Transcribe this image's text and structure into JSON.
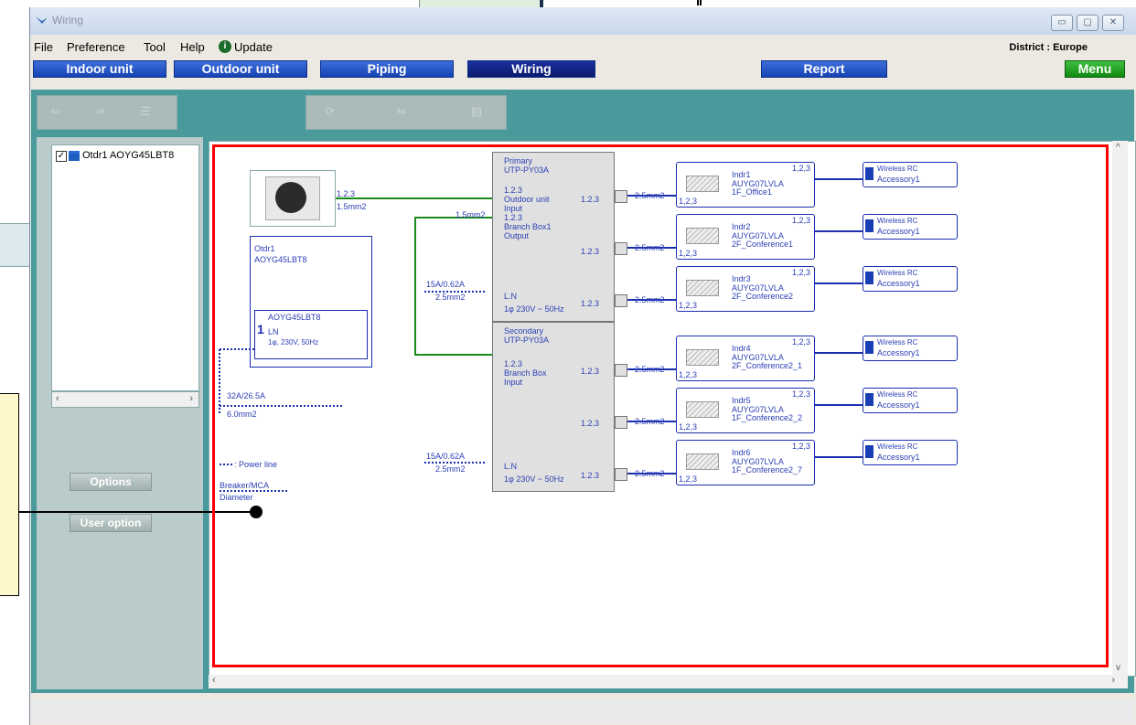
{
  "window": {
    "title": "Wiring",
    "controls": {
      "minimize": "▭",
      "maximize": "▢",
      "close": "✕"
    }
  },
  "menu": {
    "items": [
      "File",
      "Preference",
      "Tool",
      "Help",
      "Update"
    ],
    "district": "District : Europe"
  },
  "tabs": {
    "indoor": "Indoor unit",
    "outdoor": "Outdoor unit",
    "piping": "Piping",
    "wiring": "Wiring",
    "report": "Report",
    "menu": "Menu"
  },
  "tree": {
    "item": "Otdr1 AOYG45LBT8"
  },
  "side": {
    "options": "Options",
    "user_option": "User option"
  },
  "outdoor": {
    "name": "Otdr1",
    "model": "AOYG45LBT8",
    "inner_model": "AOYG45LBT8",
    "number": "1",
    "ln": "LN",
    "power": "1φ, 230V, 50Hz",
    "conn": "1.2.3",
    "wire": "1.5mm2",
    "breaker": "32A/26.5A",
    "diameter": "6.0mm2"
  },
  "legend": {
    "power_line": ": Power line",
    "breaker_mca": "Breaker/MCA",
    "diameter": "Diameter"
  },
  "primary": {
    "title": "Primary",
    "model": "UTP-PY03A",
    "conn1": "1.2.3",
    "l1": "Outdoor unit",
    "l2": "Input",
    "conn2": "1.2.3",
    "l3": "Branch Box1",
    "l4": "Output",
    "ln": "L.N",
    "power": "1φ 230V ~ 50Hz",
    "port": "1.2.3",
    "wire_in": "1.5mm2",
    "breaker": "15A/0.62A",
    "diameter": "2.5mm2"
  },
  "secondary": {
    "title": "Secondary",
    "model": "UTP-PY03A",
    "conn1": "1.2.3",
    "l1": "Branch Box",
    "l2": "Input",
    "ln": "L.N",
    "power": "1φ 230V ~ 50Hz",
    "port": "1.2.3",
    "breaker": "15A/0.62A",
    "diameter": "2.5mm2"
  },
  "indoor": [
    {
      "name": "Indr1",
      "model": "AUYG07LVLA",
      "room": "1F_Office1",
      "wire": "2.5mm2",
      "conn": "1,2,3"
    },
    {
      "name": "Indr2",
      "model": "AUYG07LVLA",
      "room": "2F_Conference1",
      "wire": "2.5mm2",
      "conn": "1,2,3"
    },
    {
      "name": "Indr3",
      "model": "AUYG07LVLA",
      "room": "2F_Conference2",
      "wire": "2.5mm2",
      "conn": "1,2,3"
    },
    {
      "name": "Indr4",
      "model": "AUYG07LVLA",
      "room": "2F_Conference2_1",
      "wire": "2.5mm2",
      "conn": "1,2,3"
    },
    {
      "name": "Indr5",
      "model": "AUYG07LVLA",
      "room": "1F_Conference2_2",
      "wire": "2.5mm2",
      "conn": "1,2,3"
    },
    {
      "name": "Indr6",
      "model": "AUYG07LVLA",
      "room": "1F_Conference2_7",
      "wire": "2.5mm2",
      "conn": "1,2,3"
    }
  ],
  "remote": {
    "label": "Wireless RC",
    "sub": "Accessory1"
  },
  "colors": {
    "accent_blue": "#1743b4",
    "active_tab": "#0a1a6a",
    "menu_green": "#118a11",
    "red_frame": "#ff0000",
    "teal": "#4a9a9c",
    "wire_green": "#1a8a1a"
  }
}
